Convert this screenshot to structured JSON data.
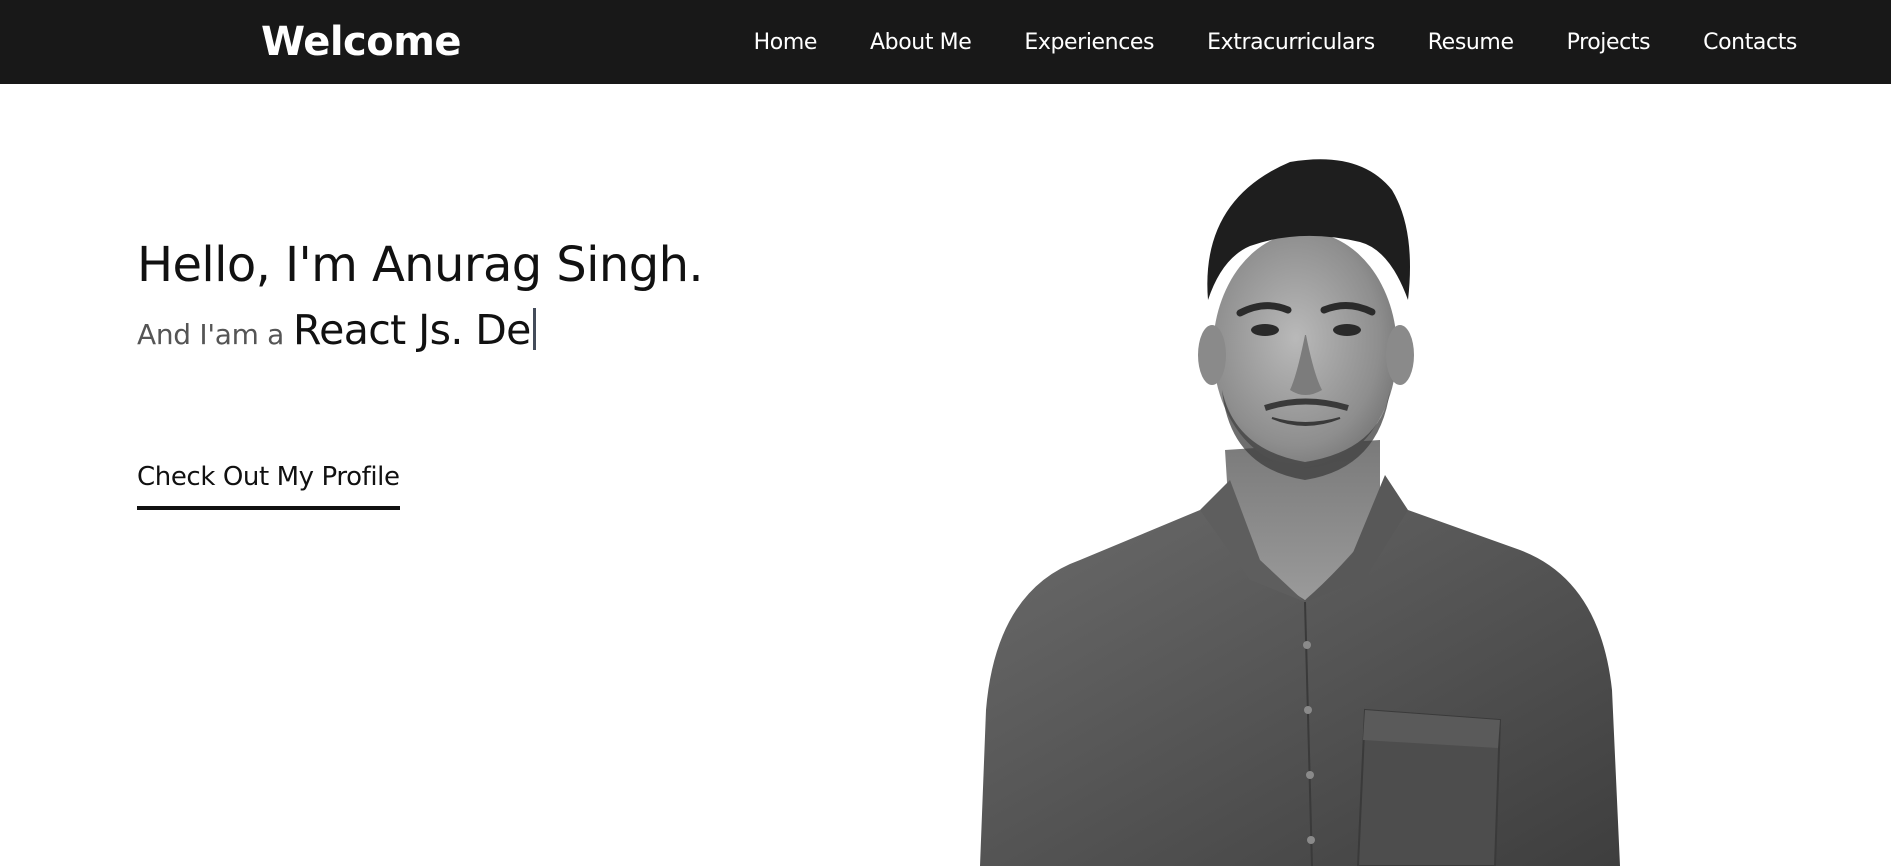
{
  "navbar": {
    "brand": "Welcome",
    "links": [
      "Home",
      "About Me",
      "Experiences",
      "Extracurriculars",
      "Resume",
      "Projects",
      "Contacts"
    ]
  },
  "hero": {
    "greeting": "Hello, I'm Anurag Singh.",
    "role_prefix": "And I'am a",
    "role_typed": "React Js. De",
    "cta_label": "Check Out My Profile"
  },
  "colors": {
    "navbar_bg": "#181818",
    "nav_text": "#ffffff",
    "page_bg": "#ffffff",
    "heading_text": "#111111",
    "muted_text": "#555555"
  },
  "icons": {
    "portrait": "person-photo"
  }
}
